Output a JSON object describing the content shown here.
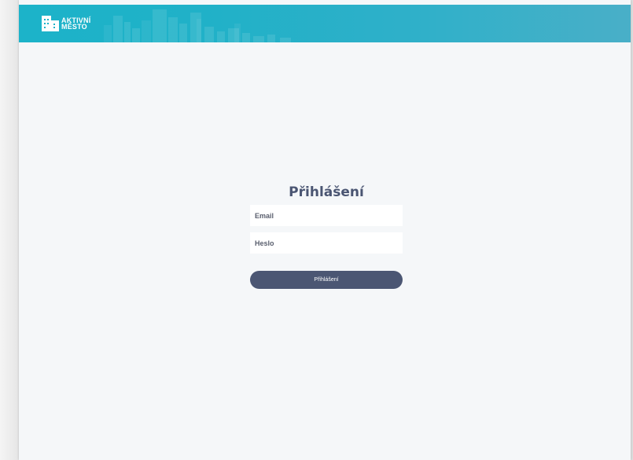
{
  "brand": {
    "line1": "AKTIVNÍ",
    "line2": "MĚSTO"
  },
  "login": {
    "title": "Přihlášení",
    "email_placeholder": "Email",
    "password_placeholder": "Heslo",
    "submit_label": "Přihlášení"
  },
  "colors": {
    "header_start": "#1cb3c9",
    "header_end": "#49afc8",
    "page_background": "#f5f7f9",
    "title_text": "#4a5572",
    "button_background": "#4b5673",
    "button_text": "#ffffff"
  },
  "icons": {
    "logo": "city-building-icon"
  }
}
